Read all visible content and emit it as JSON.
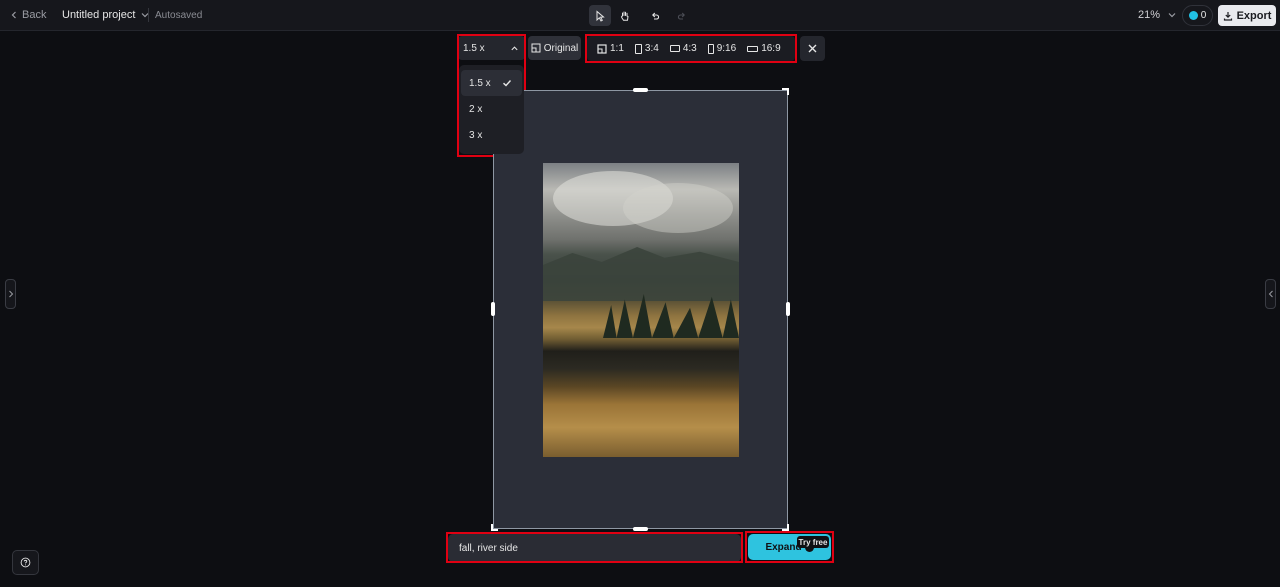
{
  "header": {
    "back_label": "Back",
    "project_name": "Untitled project",
    "save_status": "Autosaved",
    "zoom_level": "21%",
    "credits": "0",
    "export_label": "Export"
  },
  "toolbar": {
    "scale_selected": "1.5 x",
    "original_label": "Original",
    "aspect_ratios": [
      "1:1",
      "3:4",
      "4:3",
      "9:16",
      "16:9"
    ]
  },
  "scale_menu": {
    "options": [
      "1.5 x",
      "2 x",
      "3 x"
    ],
    "selected_index": 0
  },
  "prompt": {
    "value": "fall, river side"
  },
  "expand_button": {
    "label": "Expand",
    "badge": "Try free",
    "accent_color": "#2ec3df"
  },
  "icons": [
    "chevron-left-icon",
    "chevron-down-icon",
    "pointer-icon",
    "hand-icon",
    "undo-icon",
    "redo-icon",
    "download-icon",
    "original-ratio-icon",
    "close-icon",
    "check-icon",
    "help-icon"
  ]
}
